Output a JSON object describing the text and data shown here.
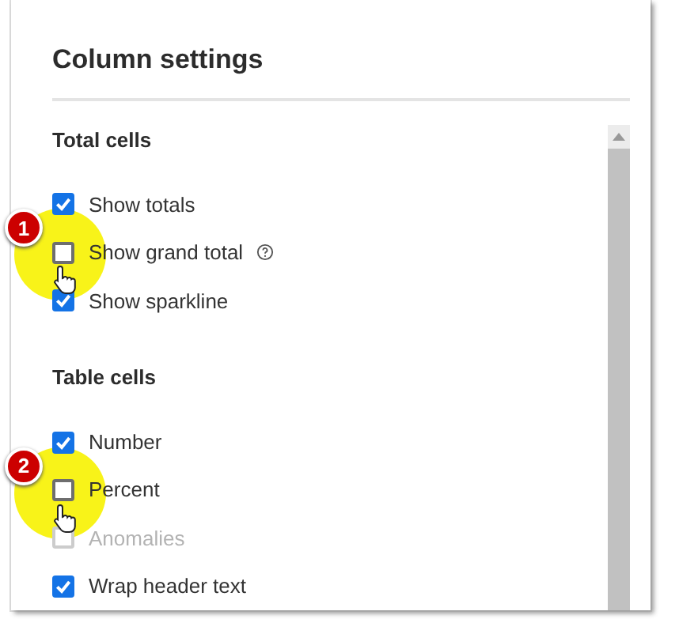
{
  "panel": {
    "title": "Column settings"
  },
  "sections": [
    {
      "heading": "Total cells",
      "items": [
        {
          "label": "Show totals",
          "checked": true,
          "disabled": false
        },
        {
          "label": "Show grand total",
          "checked": false,
          "disabled": false,
          "help": true,
          "callout": "1"
        },
        {
          "label": "Show sparkline",
          "checked": true,
          "disabled": false
        }
      ]
    },
    {
      "heading": "Table cells",
      "items": [
        {
          "label": "Number",
          "checked": true,
          "disabled": false
        },
        {
          "label": "Percent",
          "checked": false,
          "disabled": false,
          "callout": "2"
        },
        {
          "label": "Anomalies",
          "checked": false,
          "disabled": true
        },
        {
          "label": "Wrap header text",
          "checked": true,
          "disabled": false
        }
      ]
    }
  ]
}
